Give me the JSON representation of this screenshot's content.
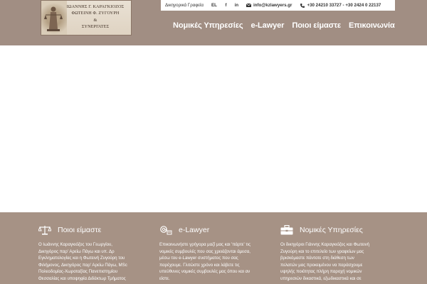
{
  "logo": {
    "lines": [
      "ΙΩΑΝΝΗΣ Γ. ΚΑΡΑΓΚΙΟΖΟΣ",
      "ΦΩΤΕΙΝΗ Φ. ΖΥΓΟΥΡΗ",
      "&",
      "ΣΥΝΕΡΓΑΤΕΣ"
    ],
    "icon": "lady-justice-icon"
  },
  "topbar": {
    "offices": "Δικηγορικά Γραφεία",
    "language": "EL",
    "facebook": "f",
    "linkedin": "in",
    "email": "info@kzlawyers.gr",
    "phones": "+30 24210 33727 - +30 2424 0 22137"
  },
  "nav": {
    "items": [
      "Νομικές Υπηρεσίες",
      "e-Lawyer",
      "Ποιοι είμαστε",
      "Επικοινωνία"
    ]
  },
  "footer": {
    "columns": [
      {
        "icon": "scales-icon",
        "title": "Ποιοι είμαστε",
        "lines": [
          "Ο Ιωάννης Καραγκιόζος του Γεωργίου,",
          "Δικηγόρος παρ' Αρείω Πάγω και υπ. Δρ",
          "Εγκληματολογίας και η Φωτεινή Ζυγούρη του",
          "Φιλήμονος, Δικηγόρος παρ' Αρείω Πάγω, MSc",
          "Πολεοδομίας-Χωροταξίας Πανεπιστημίου",
          "Θεσσαλίας και υποψηφία Διδάκτωρ Τμήματος"
        ]
      },
      {
        "icon": "e-lawyer-icon",
        "title": "e-Lawyer",
        "lines": [
          "Επικοινωνήστε γρήγορα μαζί μας και 'πάρτε' τις",
          "νομικές συμβουλές που σας χρειάζονται άμεσα,",
          "μέσω του e-Lawyer συστήματος που σας",
          "παρέχουμε. Γλιτώστε χρόνο και λάβετε τις",
          "υπεύθυνες νομικές συμβουλές μας όπου και αν",
          "είστε."
        ]
      },
      {
        "icon": "briefcase-icon",
        "title": "Νομικές Υπηρεσίες",
        "lines": [
          "Οι δικηγόροι Γιάννης Καραγκιόζος και Φωτεινή",
          "Ζυγούρη και το επιτελείο των γραφείων μας",
          "βρισκόμαστε πάντοτε στη διάθεση των",
          "πελατών μας προκειμένου να παράσχουμε",
          "υψηλής ποιότητας πλήρη παροχή νομικών",
          "υπηρεσιών δικαστικά, εξωδικαστικά και σε"
        ]
      }
    ]
  },
  "colors": {
    "header_bg": "#a18e83",
    "footer_bg": "#a69285",
    "text_light": "#ffffff"
  }
}
